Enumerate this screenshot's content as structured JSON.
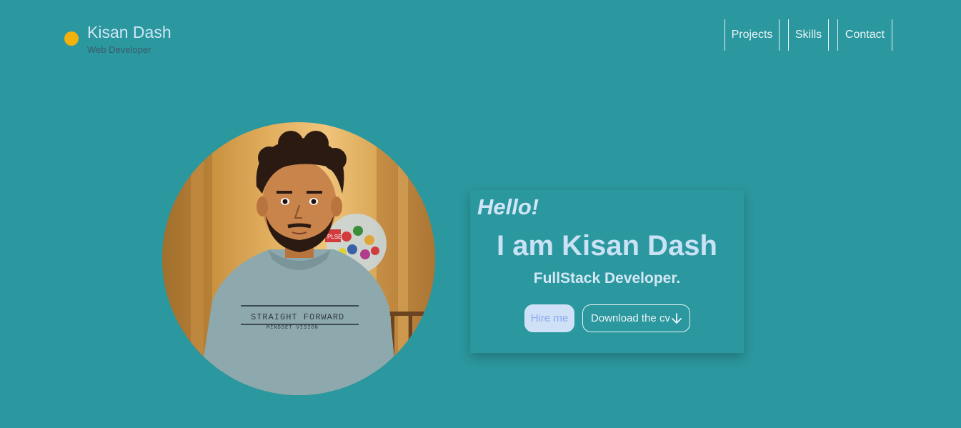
{
  "brand": {
    "name": "Kisan Dash",
    "role": "Web Developer",
    "dot_color": "#f2b10d"
  },
  "nav": {
    "items": [
      {
        "label": "Projects"
      },
      {
        "label": "Skills"
      },
      {
        "label": "Contact"
      }
    ]
  },
  "hero": {
    "greeting": "Hello!",
    "headline": "I am Kisan Dash",
    "role": "FullStack Developer.",
    "hire_label": "Hire me",
    "cv_label": "Download the cv",
    "cv_icon": "arrow-down-icon",
    "avatar": {
      "alt": "profile-avatar",
      "sweater_text": "STRAIGHT FORWARD",
      "sweater_subtext": "MINDSET VISION",
      "sign_text": "PLSE"
    }
  },
  "colors": {
    "background": "#2b979e",
    "text_light": "#cfe6f6",
    "accent": "#f2b10d"
  }
}
